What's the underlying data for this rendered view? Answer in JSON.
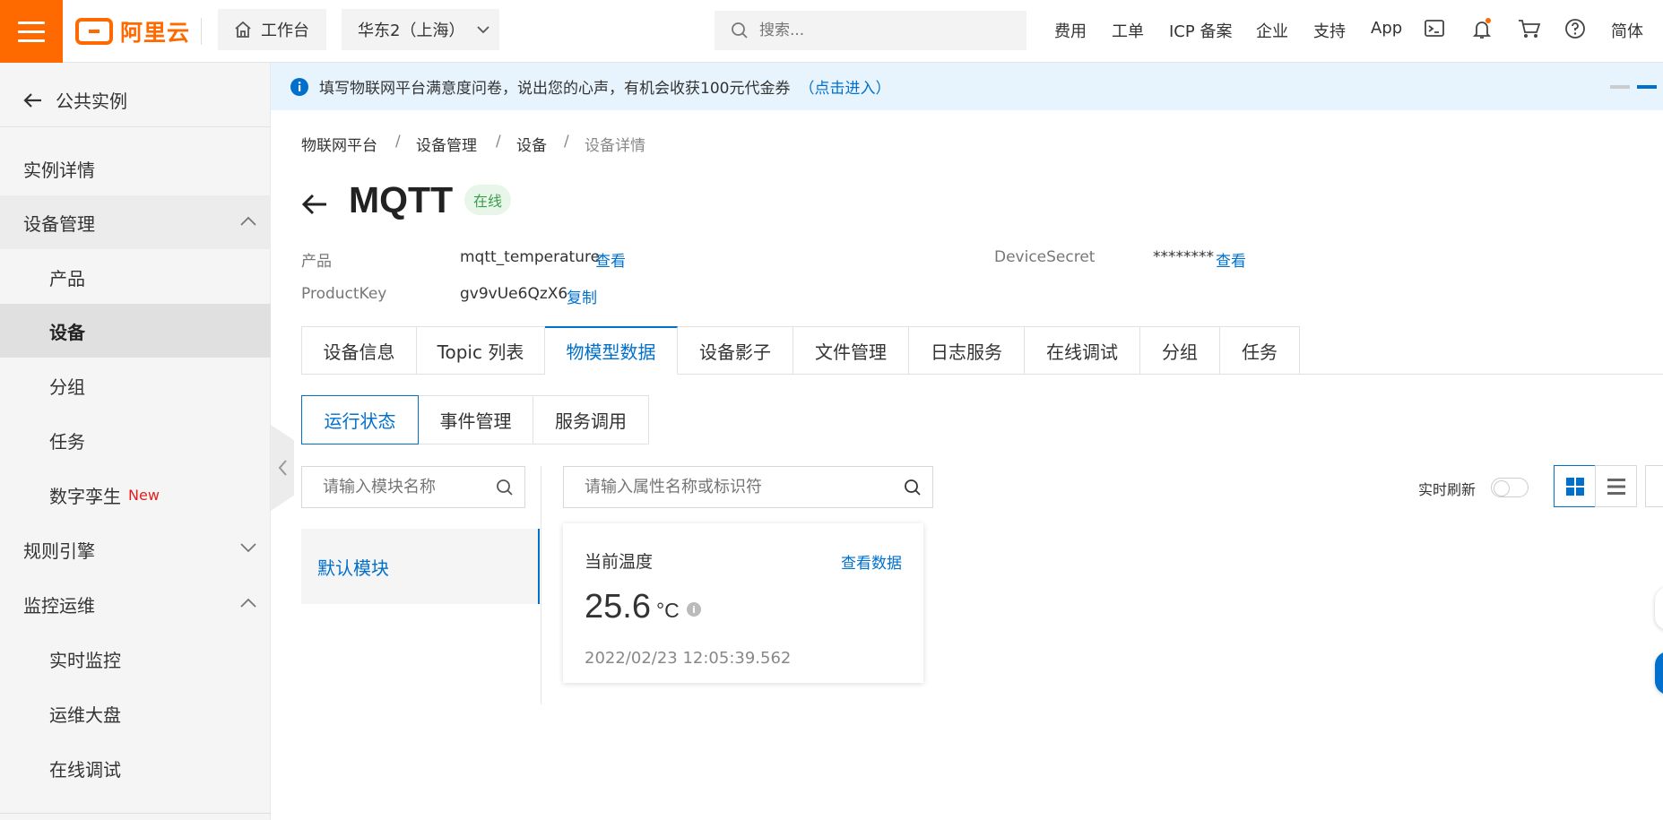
{
  "topbar": {
    "logo_text": "阿里云",
    "workbench": "工作台",
    "region": "华东2（上海）",
    "search_placeholder": "搜索...",
    "links": [
      "费用",
      "工单",
      "ICP 备案",
      "企业",
      "支持",
      "App"
    ],
    "lang": "简体"
  },
  "sidebar": {
    "back": "公共实例",
    "items": [
      {
        "label": "实例详情"
      },
      {
        "label": "设备管理"
      },
      {
        "label": "产品"
      },
      {
        "label": "设备"
      },
      {
        "label": "分组"
      },
      {
        "label": "任务"
      },
      {
        "label": "数字孪生",
        "badge": "New"
      },
      {
        "label": "规则引擎"
      },
      {
        "label": "监控运维"
      },
      {
        "label": "实时监控"
      },
      {
        "label": "运维大盘"
      },
      {
        "label": "在线调试"
      }
    ]
  },
  "notice": {
    "text": "填写物联网平台满意度问卷，说出您的心声，有机会收获100元代金券",
    "link": "（点击进入）"
  },
  "breadcrumb": [
    "物联网平台",
    "设备管理",
    "设备",
    "设备详情"
  ],
  "device": {
    "name": "MQTT",
    "status": "在线",
    "product_label": "产品",
    "product_value": "mqtt_temperature",
    "product_link": "查看",
    "productkey_label": "ProductKey",
    "productkey_value": "gv9vUe6QzX6",
    "productkey_link": "复制",
    "secret_label": "DeviceSecret",
    "secret_value": "********",
    "secret_link": "查看"
  },
  "tabs": [
    "设备信息",
    "Topic 列表",
    "物模型数据",
    "设备影子",
    "文件管理",
    "日志服务",
    "在线调试",
    "分组",
    "任务"
  ],
  "subtabs": [
    "运行状态",
    "事件管理",
    "服务调用"
  ],
  "module_search_placeholder": "请输入模块名称",
  "property_search_placeholder": "请输入属性名称或标识符",
  "module": "默认模块",
  "realtime_label": "实时刷新",
  "card": {
    "name": "当前温度",
    "view": "查看数据",
    "value": "25.6",
    "unit": "°C",
    "time": "2022/02/23 12:05:39.562"
  }
}
